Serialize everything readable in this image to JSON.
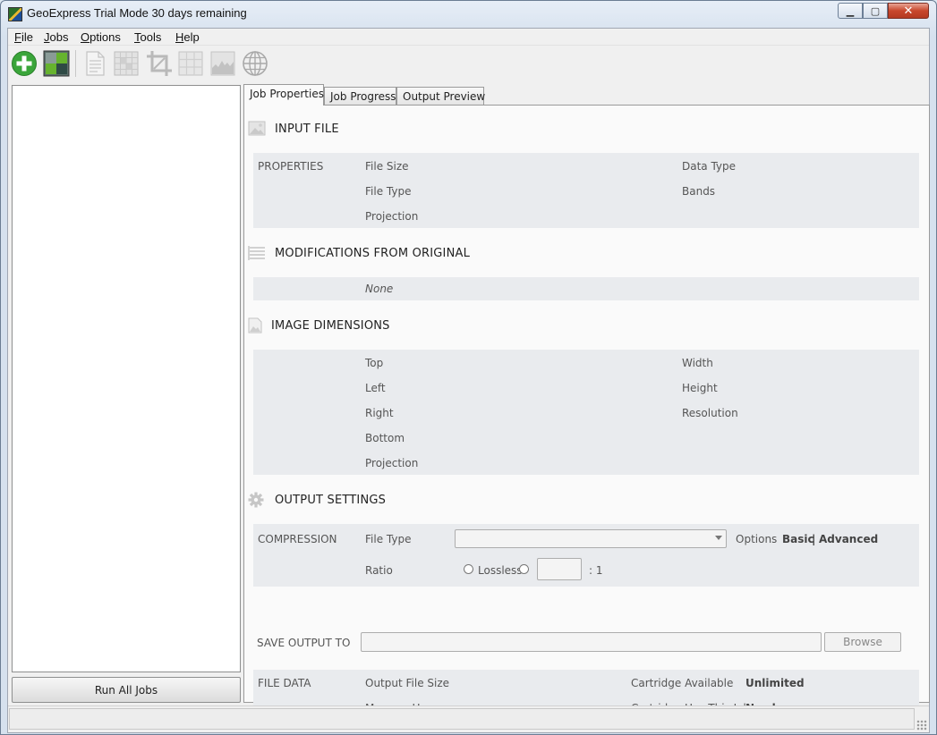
{
  "window": {
    "title": "GeoExpress Trial Mode 30 days remaining",
    "minimize": "▁",
    "maximize": "▢",
    "close": "✕"
  },
  "menu": [
    {
      "key": "F",
      "rest": "ile"
    },
    {
      "key": "J",
      "rest": "obs"
    },
    {
      "key": "O",
      "rest": "ptions"
    },
    {
      "key": "T",
      "rest": "ools"
    },
    {
      "key": "H",
      "rest": "elp"
    }
  ],
  "toolbar": {
    "icons": [
      "add-job-icon",
      "mosaic-icon",
      "document-icon",
      "grid-icon",
      "crop-icon",
      "tiles-icon",
      "histogram-icon",
      "globe-icon"
    ]
  },
  "left_panel": {
    "run_all_label": "Run All Jobs"
  },
  "tabs": [
    "Job Properties",
    "Job Progress",
    "Output Preview"
  ],
  "input_file": {
    "title": "INPUT FILE",
    "group_label": "PROPERTIES",
    "left_fields": [
      "File Size",
      "File Type",
      "Projection"
    ],
    "right_fields": [
      "Data Type",
      "Bands"
    ]
  },
  "modifications": {
    "title": "MODIFICATIONS FROM ORIGINAL",
    "value": "None"
  },
  "image_dimensions": {
    "title": "IMAGE DIMENSIONS",
    "left_fields": [
      "Top",
      "Left",
      "Right",
      "Bottom",
      "Projection"
    ],
    "right_fields": [
      "Width",
      "Height",
      "Resolution"
    ]
  },
  "output_settings": {
    "title": "OUTPUT SETTINGS",
    "compression_label": "COMPRESSION",
    "file_type_label": "File Type",
    "file_type_value": "",
    "options_label": "Options",
    "basic_label": "Basic",
    "separator": "|",
    "advanced_label": "Advanced",
    "ratio_label": "Ratio",
    "lossless_label": "Lossless",
    "ratio_value": "",
    "ratio_suffix": ": 1",
    "save_output_label": "SAVE OUTPUT TO",
    "save_output_value": "",
    "browse_label": "Browse",
    "file_data_label": "FILE DATA",
    "output_file_size_label": "Output File Size",
    "memory_usage_label": "Memory Usage",
    "cartridge_available_label": "Cartridge Available",
    "cartridge_available_value": "Unlimited",
    "cartridge_use_label": "Cartridge Use This Job",
    "cartridge_use_value": "No charge"
  },
  "colors": {
    "add_green": "#3aa53a",
    "band_bg": "#e9ebee"
  }
}
